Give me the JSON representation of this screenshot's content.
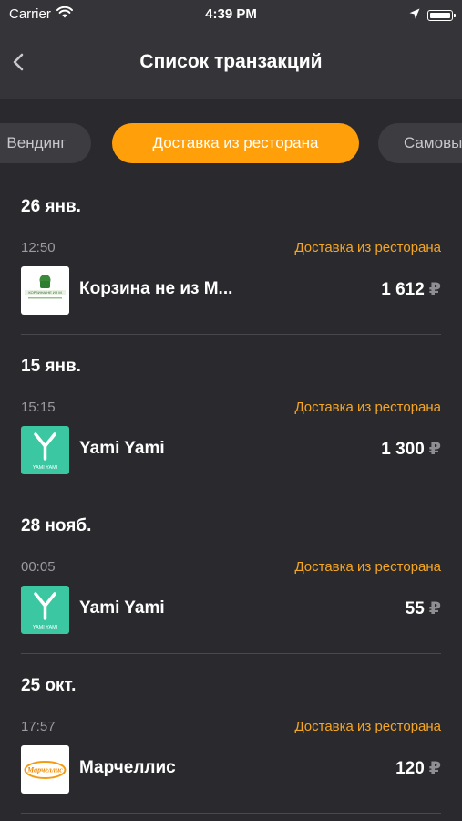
{
  "status": {
    "carrier": "Carrier",
    "time": "4:39 PM"
  },
  "nav": {
    "title": "Список транзакций"
  },
  "filters": [
    "Вендинг",
    "Доставка из ресторана",
    "Самовывоз"
  ],
  "currency": "₽",
  "transactions": [
    {
      "date": "26 янв.",
      "time": "12:50",
      "category": "Доставка из ресторана",
      "merchant": "Корзина не из М...",
      "amount": "1 612",
      "logo_text": "КОРЗИНА НЕ ИЗ М"
    },
    {
      "date": "15 янв.",
      "time": "15:15",
      "category": "Доставка из ресторана",
      "merchant": "Yami Yami",
      "amount": "1 300",
      "logo_text": "YAMI YAMI"
    },
    {
      "date": "28 нояб.",
      "time": "00:05",
      "category": "Доставка из ресторана",
      "merchant": "Yami Yami",
      "amount": "55",
      "logo_text": "YAMI YAMI"
    },
    {
      "date": "25 окт.",
      "time": "17:57",
      "category": "Доставка из ресторана",
      "merchant": "Марчеллис",
      "amount": "120",
      "logo_text": "Марчеллис"
    }
  ],
  "colors": {
    "accent": "#ff9f0a",
    "category": "#f5a623",
    "background": "#2a2a2e",
    "yami": "#3cc7a3"
  }
}
